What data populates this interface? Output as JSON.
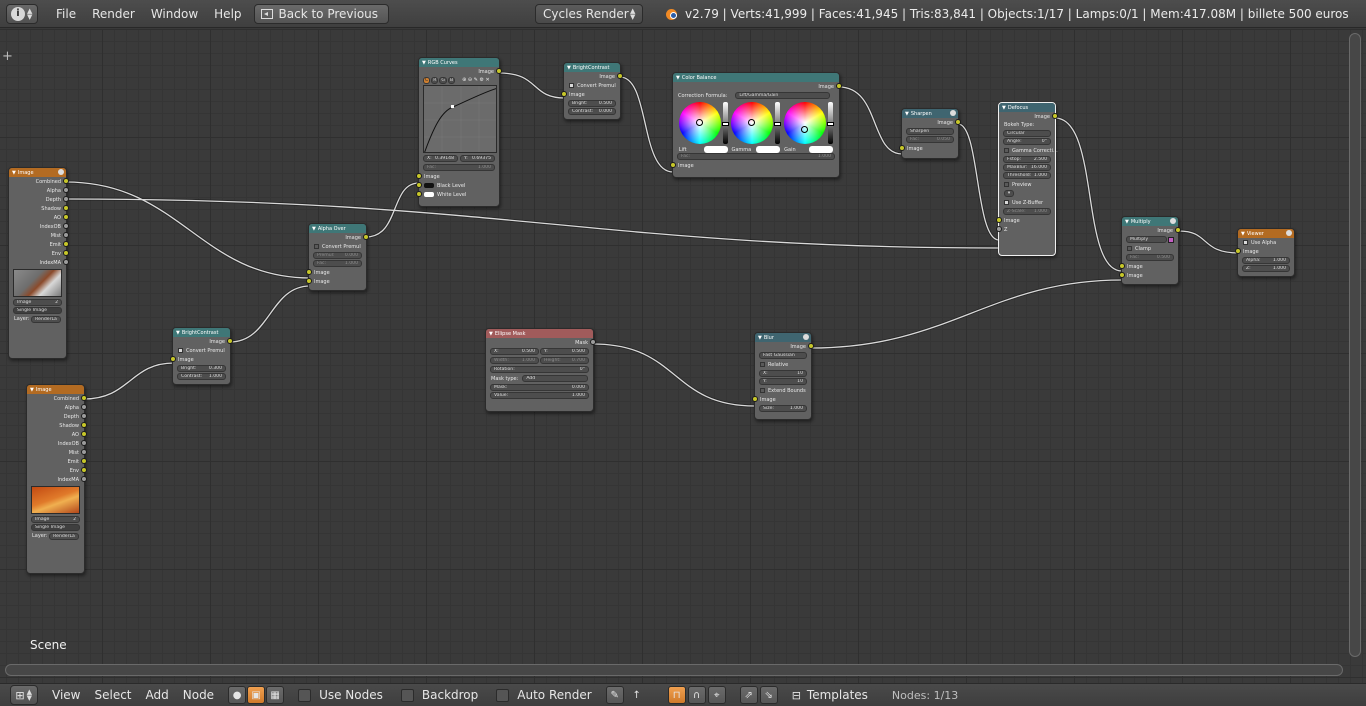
{
  "topbar": {
    "menus": [
      "File",
      "Render",
      "Window",
      "Help"
    ],
    "back_label": "Back to Previous",
    "engine": "Cycles Render",
    "stats": "v2.79 | Verts:41,999 | Faces:41,945 | Tris:83,841 | Objects:1/17 | Lamps:0/1 | Mem:417.08M | billete 500 euros"
  },
  "canvas": {
    "scene_label": "Scene"
  },
  "nodes": {
    "image1": {
      "title": "Image",
      "outputs": [
        "Combined",
        "Alpha",
        "Depth",
        "Shadow",
        "AO",
        "IndexOB",
        "Mist",
        "Emit",
        "Env",
        "IndexMA"
      ],
      "image_name": "Image",
      "users": "2",
      "source": "Single Image",
      "layer_label": "Layer:",
      "layer_value": "RenderLa"
    },
    "image2": {
      "title": "Image",
      "outputs": [
        "Combined",
        "Alpha",
        "Depth",
        "Shadow",
        "AO",
        "IndexOB",
        "Mist",
        "Emit",
        "Env",
        "IndexMA"
      ],
      "image_name": "Image",
      "users": "2",
      "source": "Single Image",
      "layer_label": "Layer:",
      "layer_value": "RenderLa"
    },
    "bright1": {
      "title": "BrightContrast",
      "output": "Image",
      "convert": "Convert Premul",
      "input": "Image",
      "bright_label": "Bright:",
      "bright": "0.300",
      "contrast_label": "Contrast:",
      "contrast": "1.000"
    },
    "alphaover": {
      "title": "Alpha Over",
      "output": "Image",
      "convert": "Convert Premul",
      "premul_label": "Premul:",
      "premul": "0.000",
      "fac_label": "Fac:",
      "fac": "1.000",
      "inputs": [
        "Image",
        "Image"
      ]
    },
    "rgbcurves": {
      "title": "RGB Curves",
      "output": "Image",
      "x_label": "X:",
      "x": "0.39148",
      "y_label": "Y:",
      "y": "0.69375",
      "fac_label": "Fac:",
      "fac": "1.000",
      "input": "Image",
      "black": "Black Level",
      "white": "White Level",
      "tabs": [
        "C",
        "R",
        "G",
        "B"
      ]
    },
    "bright2": {
      "title": "BrightContrast",
      "output": "Image",
      "convert": "Convert Premul",
      "input": "Image",
      "bright_label": "Bright:",
      "bright": "0.500",
      "contrast_label": "Contrast:",
      "contrast": "0.000"
    },
    "colorbalance": {
      "title": "Color Balance",
      "output": "Image",
      "formula_label": "Correction Formula:",
      "formula": "Lift/Gamma/Gain",
      "wheels": [
        "Lift",
        "Gamma",
        "Gain"
      ],
      "fac_label": "Fac:",
      "fac": "1.000",
      "input": "Image"
    },
    "sharpen": {
      "title": "Sharpen",
      "output": "Image",
      "mode": "Sharpen",
      "fac_label": "Fac:",
      "fac": "0.050",
      "input": "Image"
    },
    "defocus": {
      "title": "Defocus",
      "output": "Image",
      "bokeh_label": "Bokeh Type:",
      "bokeh": "Circular",
      "angle_label": "Angle:",
      "angle": "0°",
      "gamma": "Gamma Correcti...",
      "fstop_label": "Fstop:",
      "fstop": "2.500",
      "maxblur_label": "MaxBlur:",
      "maxblur": "16.000",
      "threshold_label": "Threshold:",
      "threshold": "1.000",
      "preview": "Preview",
      "zbuffer": "Use Z-Buffer",
      "zscale_label": "Z-Scale:",
      "zscale": "1.000",
      "inputs": [
        "Image",
        "Z"
      ]
    },
    "multiply": {
      "title": "Multiply",
      "output": "Image",
      "blend": "Multiply",
      "clamp": "Clamp",
      "fac_label": "Fac:",
      "fac": "0.500",
      "inputs": [
        "Image",
        "Image"
      ]
    },
    "viewer": {
      "title": "Viewer",
      "use_alpha": "Use Alpha",
      "input": "Image",
      "alpha_label": "Alpha:",
      "alpha": "1.000",
      "z_label": "Z:",
      "z": "1.000"
    },
    "ellipse": {
      "title": "Ellipse Mask",
      "output": "Mask",
      "x_label": "X:",
      "x": "0.500",
      "y_label": "Y:",
      "y": "0.500",
      "width_label": "Width:",
      "width": "1.000",
      "height_label": "Height:",
      "height": "0.700",
      "rotation_label": "Rotation:",
      "rotation": "0°",
      "masktype_label": "Mask type:",
      "masktype": "Add",
      "mask_label": "Mask:",
      "mask": "0.000",
      "value_label": "Value:",
      "value": "1.000"
    },
    "blur": {
      "title": "Blur",
      "output": "Image",
      "filter": "Fast Gaussian",
      "relative": "Relative",
      "x_label": "X:",
      "x": "10",
      "y_label": "Y:",
      "y": "10",
      "extend": "Extend Bounds",
      "input": "Image",
      "size_label": "Size:",
      "size": "1.000"
    }
  },
  "bottombar": {
    "menus": [
      "View",
      "Select",
      "Add",
      "Node"
    ],
    "use_nodes": "Use Nodes",
    "backdrop": "Backdrop",
    "auto_render": "Auto Render",
    "templates": "Templates",
    "nodes_count": "Nodes: 1/13"
  },
  "colors": {
    "input_header": "#b36b22",
    "color_header": "#3f7777",
    "matte_header": "#a15b5b",
    "socket_color": "#c7c729",
    "socket_value": "#9c9c9c",
    "socket_vector": "#6363c7"
  }
}
